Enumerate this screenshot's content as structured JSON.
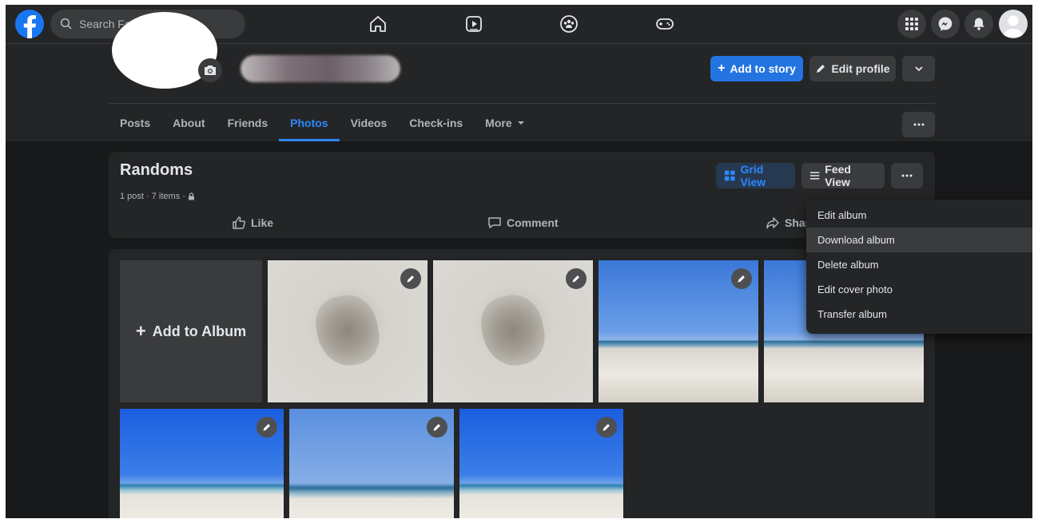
{
  "topbar": {
    "search_placeholder": "Search Facebook",
    "nav": [
      "home-icon",
      "watch-icon",
      "groups-icon",
      "gaming-icon"
    ],
    "right_icons": [
      "menu-grid-icon",
      "messenger-icon",
      "notifications-icon",
      "account-avatar"
    ]
  },
  "profile": {
    "add_story": "Add to story",
    "edit_profile": "Edit profile",
    "tabs": [
      "Posts",
      "About",
      "Friends",
      "Photos",
      "Videos",
      "Check-ins",
      "More"
    ],
    "active_tab": "Photos"
  },
  "album": {
    "title": "Randoms",
    "meta": "1 post · 7 items ·",
    "grid_view": "Grid View",
    "feed_view": "Feed View",
    "like": "Like",
    "comment": "Comment",
    "share": "Share",
    "add_to_album": "Add to Album"
  },
  "menu": {
    "items": [
      "Edit album",
      "Download album",
      "Delete album",
      "Edit cover photo",
      "Transfer album"
    ],
    "hovered": "Download album"
  },
  "colors": {
    "accent": "#2374e1",
    "active_tab": "#2d88ff",
    "background": "#18191a",
    "surface": "#242526"
  }
}
